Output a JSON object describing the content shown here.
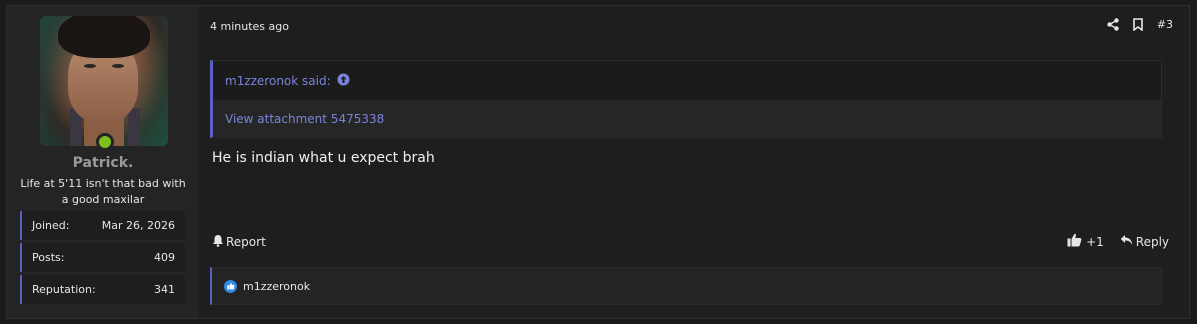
{
  "user": {
    "name": "Patrick.",
    "title": "Life at 5'11 isn't that bad with a good maxilar",
    "online_color": "#7fbf1c",
    "stats": [
      {
        "label": "Joined:",
        "value": "Mar 26, 2026"
      },
      {
        "label": "Posts:",
        "value": "409"
      },
      {
        "label": "Reputation:",
        "value": "341"
      }
    ]
  },
  "post": {
    "date": "4 minutes ago",
    "number": "#3",
    "quote": {
      "author_said": "m1zzeronok said:",
      "attachment_link": "View attachment 5475338"
    },
    "message": "He is indian what u expect brah",
    "report_label": "Report",
    "reaction_count": "+1",
    "reply_label": "Reply",
    "reactions_by": "m1zzeronok"
  },
  "colors": {
    "accent": "#5962c4",
    "link": "#7b83d9",
    "like": "#2e8ae6"
  }
}
